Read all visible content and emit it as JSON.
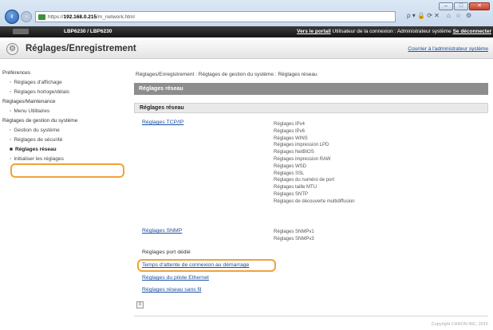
{
  "browser": {
    "url_host": "192.168.0.215",
    "url_path": "/m_network.html",
    "address_controls": "ρ ▾ 🔒 ⟳ ✕",
    "win_minimize": "–",
    "win_maximize": "□",
    "win_close": "✕"
  },
  "printer_bar": {
    "model": "LBP6230 / LBP6230",
    "portal_link": "Vers le portail",
    "user_text": "Utilisateur de la connexion : Administrateur système",
    "logout_link": "Se déconnecter"
  },
  "title": {
    "text": "Réglages/Enregistrement",
    "admin_link": "Courrier à l'administrateur système"
  },
  "sidebar": {
    "sections": [
      {
        "label": "Préférences",
        "items": [
          {
            "label": "Réglages d'affichage"
          },
          {
            "label": "Réglages horloge/délais"
          }
        ]
      },
      {
        "label": "Réglages/Maintenance",
        "items": [
          {
            "label": "Menu Utilitaires"
          }
        ]
      },
      {
        "label": "Réglages de gestion du système",
        "items": [
          {
            "label": "Gestion du système"
          },
          {
            "label": "Réglages de sécurité"
          },
          {
            "label": "Réglages réseau"
          },
          {
            "label": "Initialiser les réglages"
          }
        ]
      }
    ]
  },
  "main": {
    "breadcrumb": "Réglages/Enregistrement : Réglages de gestion du système : Réglages réseau",
    "header": "Réglages réseau",
    "subheader": "Réglages réseau",
    "tcpip_link": "Réglages TCP/IP",
    "tcpip_items": [
      "Réglages IPv4",
      "Réglages IPv6",
      "Réglages WINS",
      "Réglages impression LPD",
      "Réglages NetBIOS",
      "Réglages impression RAW",
      "Réglages WSD",
      "Réglages SSL",
      "Réglages du numéro de port",
      "Réglages taille MTU",
      "Réglages SNTP",
      "Réglages de découverte multidiffusion"
    ],
    "snmp_link": "Réglages SNMP",
    "snmp_items": [
      "Réglages SNMPv1",
      "Réglages SNMPv3"
    ],
    "dedicated_port": "Réglages port dédié",
    "wait_time_link": "Temps d'attente de connexion au démarrage",
    "ethernet_link": "Réglages du pilote Ethernet",
    "wireless_link": "Réglages réseau sans fil",
    "page_icon": "≡"
  },
  "footer": {
    "copyright": "Copyright CANON INC. 2015"
  },
  "colors": {
    "highlight": "#f0a23a",
    "link": "#1a4fa0",
    "section_header": "#8d8d8d"
  }
}
